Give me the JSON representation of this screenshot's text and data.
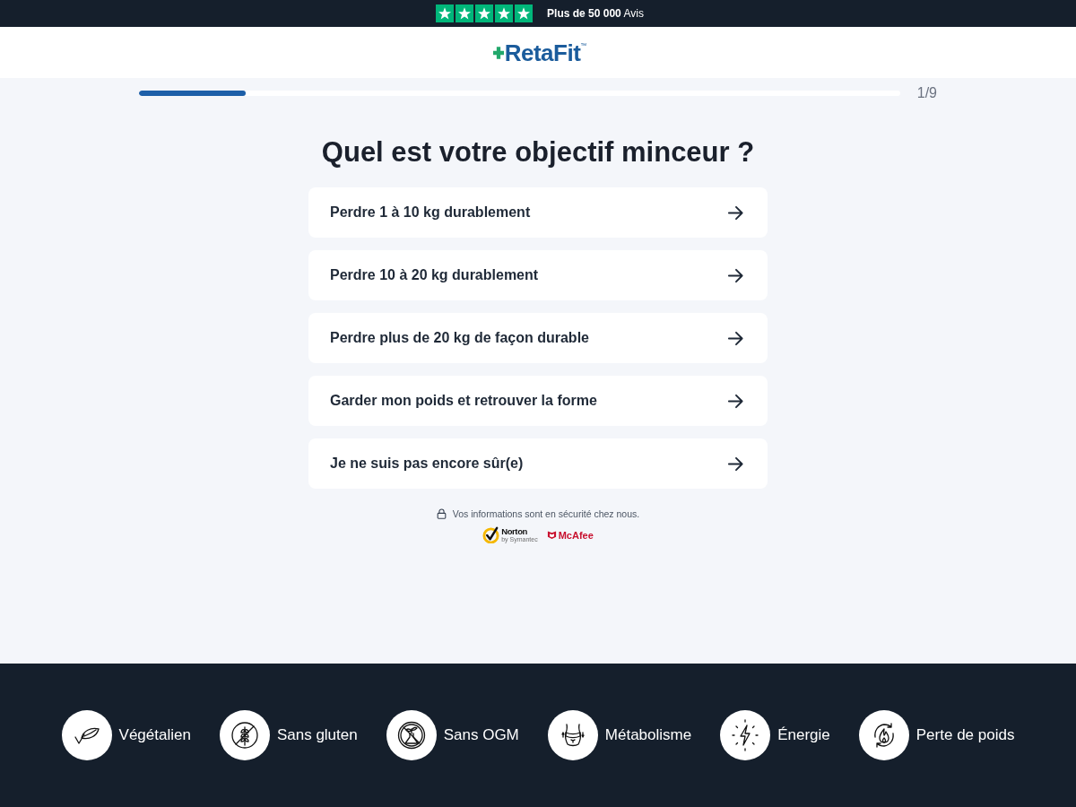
{
  "trust_bar": {
    "stars": 5,
    "text": "**Plus de 50 000** Avis"
  },
  "header": {
    "logo": "RetaFit",
    "trademark": "™"
  },
  "progress": {
    "level": 0.14,
    "label": "1/9"
  },
  "question": {
    "title": "Quel est votre objectif minceur ?",
    "options": [
      {
        "label": "Perdre 1 à 10 kg durablement"
      },
      {
        "label": "Perdre 10 à 20 kg durablement"
      },
      {
        "label": "Perdre plus de 20 kg de façon durable"
      },
      {
        "label": "Garder mon poids et retrouver la forme"
      },
      {
        "label": "Je ne suis pas encore sûr(e)"
      }
    ]
  },
  "security": {
    "text": "Vos informations sont en sécurité chez nous.",
    "badges": [
      {
        "kind": "norton",
        "name": "Norton",
        "tagline": "by Symantec"
      },
      {
        "kind": "mcafee",
        "name": "McAfee"
      }
    ]
  },
  "features": [
    {
      "kind": "vegan",
      "label": "Végétalien"
    },
    {
      "kind": "gluten_free",
      "label": "Sans gluten"
    },
    {
      "kind": "gmo_free",
      "label": "Sans OGM"
    },
    {
      "kind": "metabolism",
      "label": "Métabolisme"
    },
    {
      "kind": "energy",
      "label": "Énergie"
    },
    {
      "kind": "weight_loss",
      "label": "Perte de poids"
    }
  ]
}
